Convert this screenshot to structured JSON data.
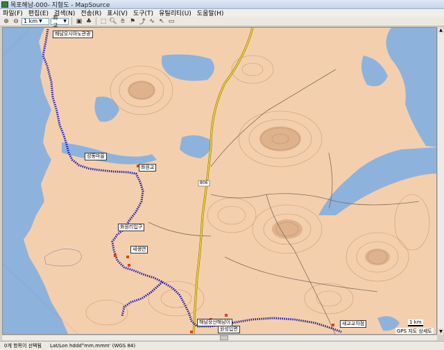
{
  "window": {
    "title": "목포해남-000- 지형도 - MapSource"
  },
  "menu": [
    "파일(F)",
    "편집(E)",
    "검색(N)",
    "전송(R)",
    "표시(V)",
    "도구(T)",
    "유틸리티(U)",
    "도움말(H)"
  ],
  "toolbar": {
    "scale_value": "1 km",
    "detail_value": "최고"
  },
  "map": {
    "route_labels": [
      "해남오시아노관광",
      "성동마을",
      "화원교",
      "화원리입구",
      "새생연",
      "해남장산해남이",
      "원성입면",
      "새교교차점"
    ],
    "vertical_label": "GPS 지도 상세도",
    "scale_text": "1 km",
    "road_marker": "806"
  },
  "status": {
    "selection": "0개 항목이 선택됨",
    "format": "Lat/Lon hddd°mm.mmm' (WGS 84)"
  }
}
